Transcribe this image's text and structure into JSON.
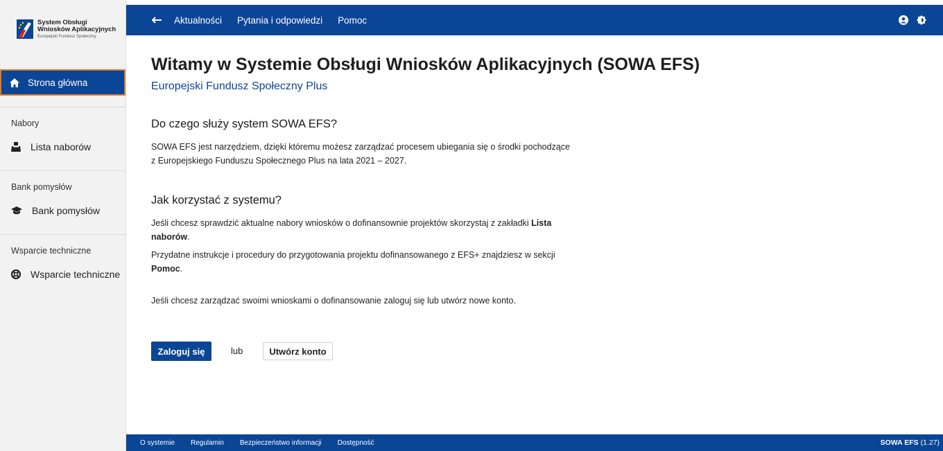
{
  "logo": {
    "line1": "System Obsługi",
    "line2": "Wniosków Aplikacyjnych",
    "line3": "Europejski Fundusz Społeczny"
  },
  "sidebar": {
    "home_label": "Strona główna",
    "sections": [
      {
        "title": "Nabory",
        "item": "Lista naborów",
        "icon": "ballot-box-icon"
      },
      {
        "title": "Bank pomysłów",
        "item": "Bank pomysłów",
        "icon": "graduation-cap-icon"
      },
      {
        "title": "Wsparcie techniczne",
        "item": "Wsparcie techniczne",
        "icon": "life-ring-icon"
      }
    ]
  },
  "topbar": {
    "menu": [
      "Aktualności",
      "Pytania i odpowiedzi",
      "Pomoc"
    ],
    "icons": [
      "user-icon",
      "contrast-icon"
    ]
  },
  "main": {
    "title": "Witamy w Systemie Obsługi Wniosków Aplikacyjnych (SOWA EFS)",
    "subtitle": "Europejski Fundusz Społeczny Plus",
    "section1_title": "Do czego służy system SOWA EFS?",
    "section1_line1": "SOWA EFS jest narzędziem, dzięki któremu możesz zarządzać procesem ubiegania się o środki pochodzące",
    "section1_line2": "z Europejskiego Funduszu Społecznego Plus na lata 2021 – 2027.",
    "section2_title": "Jak korzystać z systemu?",
    "para1_text": "Jeśli chcesz sprawdzić aktualne nabory wniosków o dofinansownie projektów skorzystaj z zakładki ",
    "para1_bold1": "Lista",
    "para1_bold2": "naborów",
    "para1_end": ".",
    "para2_text": "Przydatne instrukcje i procedury do przygotowania projektu dofinansowanego z EFS+ znajdziesz w sekcji",
    "para2_bold": "Pomoc",
    "para2_end": ".",
    "para3": "Jeśli chcesz zarządzać swoimi wnioskami o dofinansowanie zaloguj się lub utwórz nowe konto."
  },
  "actions": {
    "login": "Zaloguj się",
    "or": "lub",
    "register": "Utwórz konto"
  },
  "footer": {
    "links": [
      "O systemie",
      "Regulamin",
      "Bezpieczeństwo informacji",
      "Dostępność"
    ],
    "app_name": "SOWA EFS",
    "version": "(1.27)"
  },
  "colors": {
    "primary": "#0b4596",
    "focus_border": "#e8761f",
    "sidebar_bg": "#f2f2f2"
  }
}
